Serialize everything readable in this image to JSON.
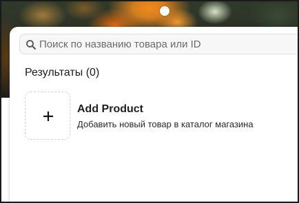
{
  "search": {
    "placeholder": "Поиск по названию товара или ID",
    "value": ""
  },
  "results": {
    "heading": "Результаты (0)"
  },
  "add_product": {
    "title": "Add Product",
    "description": "Добавить новый товар в каталог магазина",
    "icon": "plus-icon"
  },
  "icons": {
    "search": "search-icon",
    "plus": "plus-icon"
  },
  "colors": {
    "panel_background": "#ffffff",
    "search_background": "#f7f7f7",
    "text_primary": "#1a1a1a",
    "placeholder": "#6b6b6b"
  }
}
